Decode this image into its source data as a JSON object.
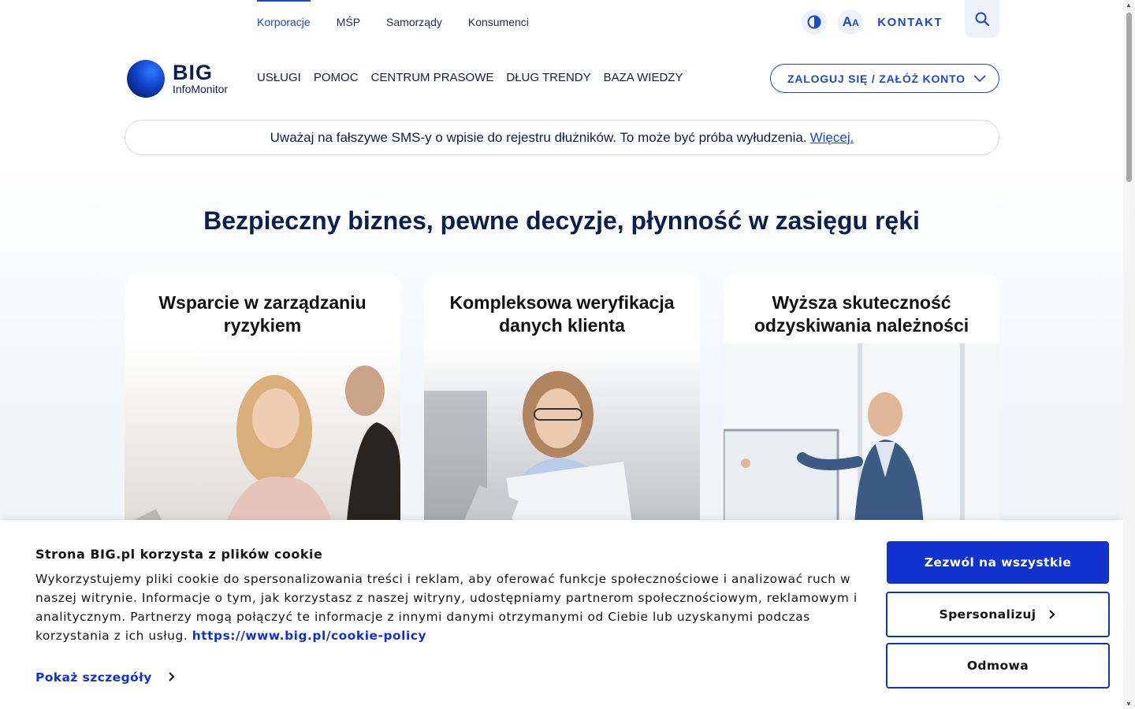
{
  "segment_nav": [
    {
      "label": "Korporacje",
      "active": true
    },
    {
      "label": "MŚP",
      "active": false
    },
    {
      "label": "Samorządy",
      "active": false
    },
    {
      "label": "Konsumenci",
      "active": false
    }
  ],
  "utility": {
    "contrast_icon": "contrast-icon",
    "font_size_label": "AA",
    "contact_label": "KONTAKT",
    "search_icon": "search-icon"
  },
  "logo": {
    "big": "BIG",
    "sub": "InfoMonitor"
  },
  "main_nav": [
    "USŁUGI",
    "POMOC",
    "CENTRUM PRASOWE",
    "DŁUG TRENDY",
    "BAZA WIEDZY"
  ],
  "login_label": "ZALOGUJ SIĘ / ZAŁÓŻ KONTO",
  "alert": {
    "text": "Uważaj na fałszywe SMS-y o wpisie do rejestru dłużników. To może być próba wyłudzenia.",
    "link": "Więcej."
  },
  "hero_title": "Bezpieczny biznes, pewne decyzje, płynność w zasięgu ręki",
  "cards": [
    {
      "title": "Wsparcie w zarządzaniu ryzykiem"
    },
    {
      "title": "Kompleksowa weryfikacja danych klienta"
    },
    {
      "title": "Wyższa skuteczność odzyskiwania należności"
    }
  ],
  "cookie": {
    "title": "Strona BIG.pl korzysta z plików cookie",
    "text": "Wykorzystujemy pliki cookie do spersonalizowania treści i reklam, aby oferować funkcje społecznościowe i analizować ruch w naszej witrynie. Informacje o tym, jak korzystasz z naszej witryny, udostępniamy partnerom społecznościowym, reklamowym i analitycznym. Partnerzy mogą połączyć te informacje z innymi danymi otrzymanymi od Ciebie lub uzyskanymi podczas korzystania z ich usług.",
    "policy_link": "https://www.big.pl/cookie-policy",
    "details_label": "Pokaż szczegóły",
    "allow_all": "Zezwól na wszystkie",
    "personalize": "Spersonalizuj",
    "deny": "Odmowa"
  },
  "colors": {
    "brand_blue": "#1c49c7",
    "navy": "#0b1f4d",
    "cookie_blue": "#1032cf"
  }
}
